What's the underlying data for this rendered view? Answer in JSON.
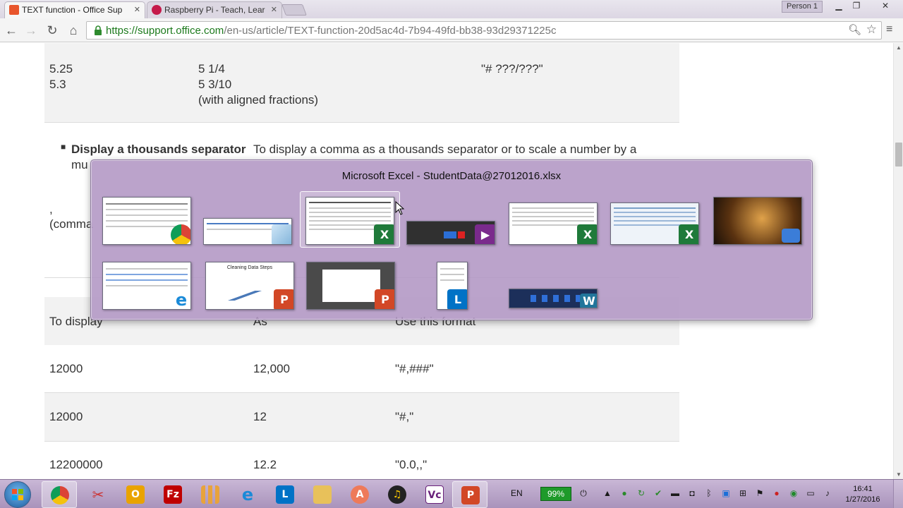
{
  "browser": {
    "tabs": [
      {
        "title": "TEXT function - Office Sup",
        "favicon": "office-icon",
        "active": true
      },
      {
        "title": "Raspberry Pi - Teach, Lear",
        "favicon": "raspberry-icon",
        "active": false
      }
    ],
    "person_label": "Person 1",
    "url_host": "https://support.office.com",
    "url_path": "/en-us/article/TEXT-function-20d5ac4d-7b94-49fd-bb38-93d29371225c"
  },
  "content": {
    "fraction_row": {
      "col1": [
        "5.25",
        "5.3"
      ],
      "col2": [
        "5 1/4",
        "5 3/10",
        "(with aligned fractions)"
      ],
      "col3": "\"# ???/???\""
    },
    "bullet": {
      "heading": "Display a thousands separator",
      "text_line1": "To display a comma as a thousands separator or to scale a number by a",
      "text_line2_start": "mu"
    },
    "comma_label": ",",
    "comma_label2": "(comma",
    "table": {
      "headers": [
        "To display",
        "As",
        "Use this format"
      ],
      "rows": [
        [
          "12000",
          "12,000",
          "\"#,###\""
        ],
        [
          "12000",
          "12",
          "\"#,\""
        ],
        [
          "12200000",
          "12.2",
          "\"0.0,,\""
        ]
      ]
    }
  },
  "switcher": {
    "title": "Microsoft Excel - StudentData@27012016.xlsx",
    "windows_row1": [
      "chrome-window",
      "paint-window",
      "excel-window-selected",
      "screen-recorder-window",
      "excel-window-2",
      "excel-window-3",
      "buddha-image-window"
    ],
    "windows_row2": [
      "internet-explorer-window",
      "powerpoint-window-cleaning-data-steps",
      "powerpoint-window-2",
      "lync-window",
      "wordpress-player-window"
    ],
    "thumb_caption": "Cleaning Data Steps"
  },
  "taskbar": {
    "apps": [
      "chrome",
      "snipping-tool",
      "outlook",
      "filezilla",
      "apps-grid",
      "internet-explorer",
      "lync",
      "file-explorer",
      "anki",
      "headphones",
      "visual-studio",
      "powerpoint"
    ],
    "language": "EN",
    "battery": "99%",
    "time": "16:41",
    "date": "1/27/2016"
  },
  "colors": {
    "url_green": "#1c7a1c",
    "switcher_purple": "#b296c4",
    "table_grey": "#f2f2f2"
  }
}
